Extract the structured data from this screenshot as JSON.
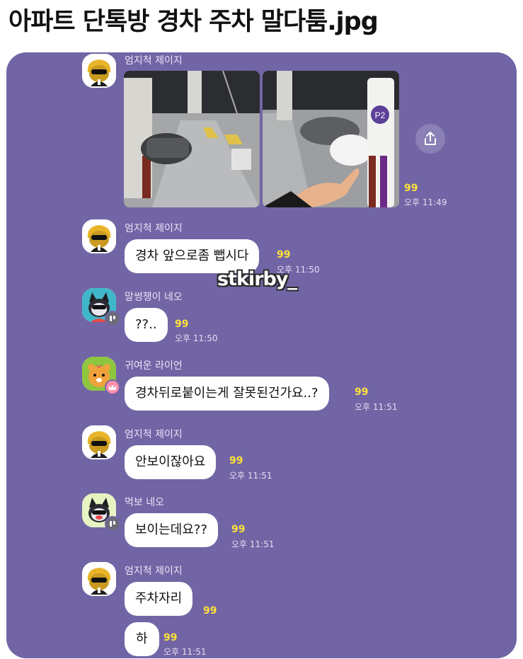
{
  "page": {
    "title": "아파트 단톡방 경차 주차 말다툼.jpg"
  },
  "watermark": "stkirby_",
  "messages": [
    {
      "sender": "엄지척 제이지",
      "type": "photos",
      "count": "99",
      "time": "오후 11:49"
    },
    {
      "sender": "엄지척 제이지",
      "text": "경차 앞으로좀 뺍시다",
      "count": "99",
      "time": "오후 11:50"
    },
    {
      "sender": "말썽쟁이 네오",
      "text": "??..",
      "count": "99",
      "time": "오후 11:50"
    },
    {
      "sender": "귀여운 라이언",
      "text": "경차뒤로붙이는게 잘못된건가요..?",
      "count": "99",
      "time": "오후 11:51"
    },
    {
      "sender": "엄지척 제이지",
      "text": "안보이잖아요",
      "count": "99",
      "time": "오후 11:51"
    },
    {
      "sender": "먹보 네오",
      "text": "보이는데요??",
      "count": "99",
      "time": "오후 11:51"
    },
    {
      "sender": "엄지척 제이지",
      "text": "주차자리",
      "count": "99"
    },
    {
      "text": "하",
      "count": "99",
      "time": "오후 11:51"
    }
  ],
  "icons": {
    "share": "share-upload-icon",
    "avatar_jayg": "jayg-character-icon",
    "avatar_neo": "neo-character-icon",
    "avatar_ryan": "ryan-character-icon",
    "badge_crown": "crown-badge-icon",
    "badge_card": "card-badge-icon"
  },
  "colors": {
    "chat_background": "#7265a5",
    "bubble": "#ffffff",
    "unread_count": "#ffe23a",
    "crown_badge": "#ff8fb0",
    "card_badge": "#6b6b78"
  }
}
